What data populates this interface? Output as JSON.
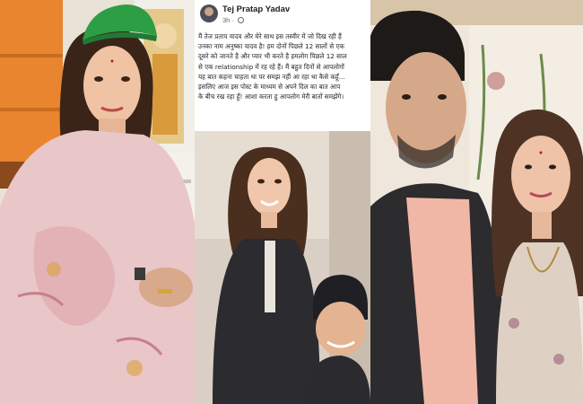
{
  "post": {
    "author": "Tej Pratap Yadav",
    "time": "3h",
    "lines": [
      "मैं तेज प्रताप यादव और मेरे साथ इस तस्वीर में जो दिख रही हैं",
      "उनका नाम अनुष्का यादव है! हम दोनों पिछले 12 सालों से एक",
      "दूसरे को जानते है और प्यार भी करते है हमलोग पिछले 12 साल",
      "से एक relationship में रह रहे हैं। मैं बहुत दिनों से आपलोगों",
      "यह बात कहना चाहता था पर समझ नहीं आ रहा था कैसे कहूँ...",
      "इसलिए आज इस पोस्ट के माध्यम से अपने दिल का बात आप",
      "के बीच रख रहा हूँ! आशा करता हु आपलोग मेरी बातों समझेंगे।"
    ]
  },
  "icons": {
    "avatar": "profile-photo",
    "audience": "globe-icon"
  },
  "colors": {
    "text": "#1c1e21",
    "meta": "#65676b",
    "saree": "#e9c6c8",
    "cap": "#2e9e45"
  }
}
